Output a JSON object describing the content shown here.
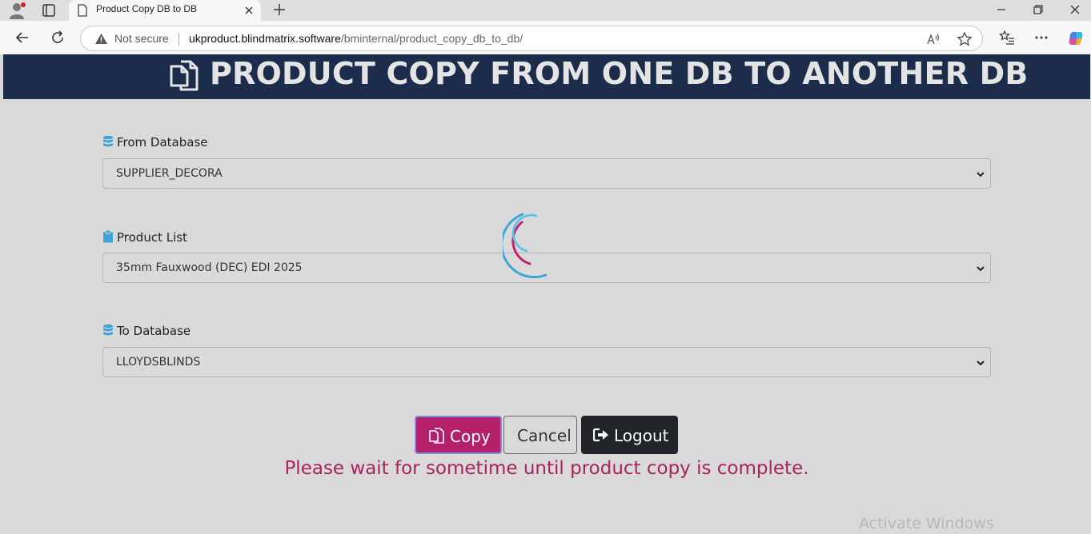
{
  "browser": {
    "tab_title": "Product Copy DB to DB",
    "security_label": "Not secure",
    "url_host": "ukproduct.blindmatrix.software",
    "url_path": "/bminternal/product_copy_db_to_db/"
  },
  "page": {
    "title": "PRODUCT COPY FROM ONE DB TO ANOTHER DB",
    "from_database": {
      "label": "From Database",
      "selected": "SUPPLIER_DECORA"
    },
    "product_list": {
      "label": "Product List",
      "selected": "35mm Fauxwood (DEC) EDI 2025"
    },
    "to_database": {
      "label": "To Database",
      "selected": "LLOYDSBLINDS"
    },
    "buttons": {
      "copy": "Copy",
      "cancel": "Cancel",
      "logout": "Logout"
    },
    "status_message": "Please wait for sometime until product copy is complete."
  },
  "watermark": "Activate Windows",
  "colors": {
    "header_bg": "#1b2d4b",
    "copy_button": "#b5206c",
    "logout_button": "#212529",
    "message": "#a8235f",
    "db_icon": "#3fa4d6"
  }
}
